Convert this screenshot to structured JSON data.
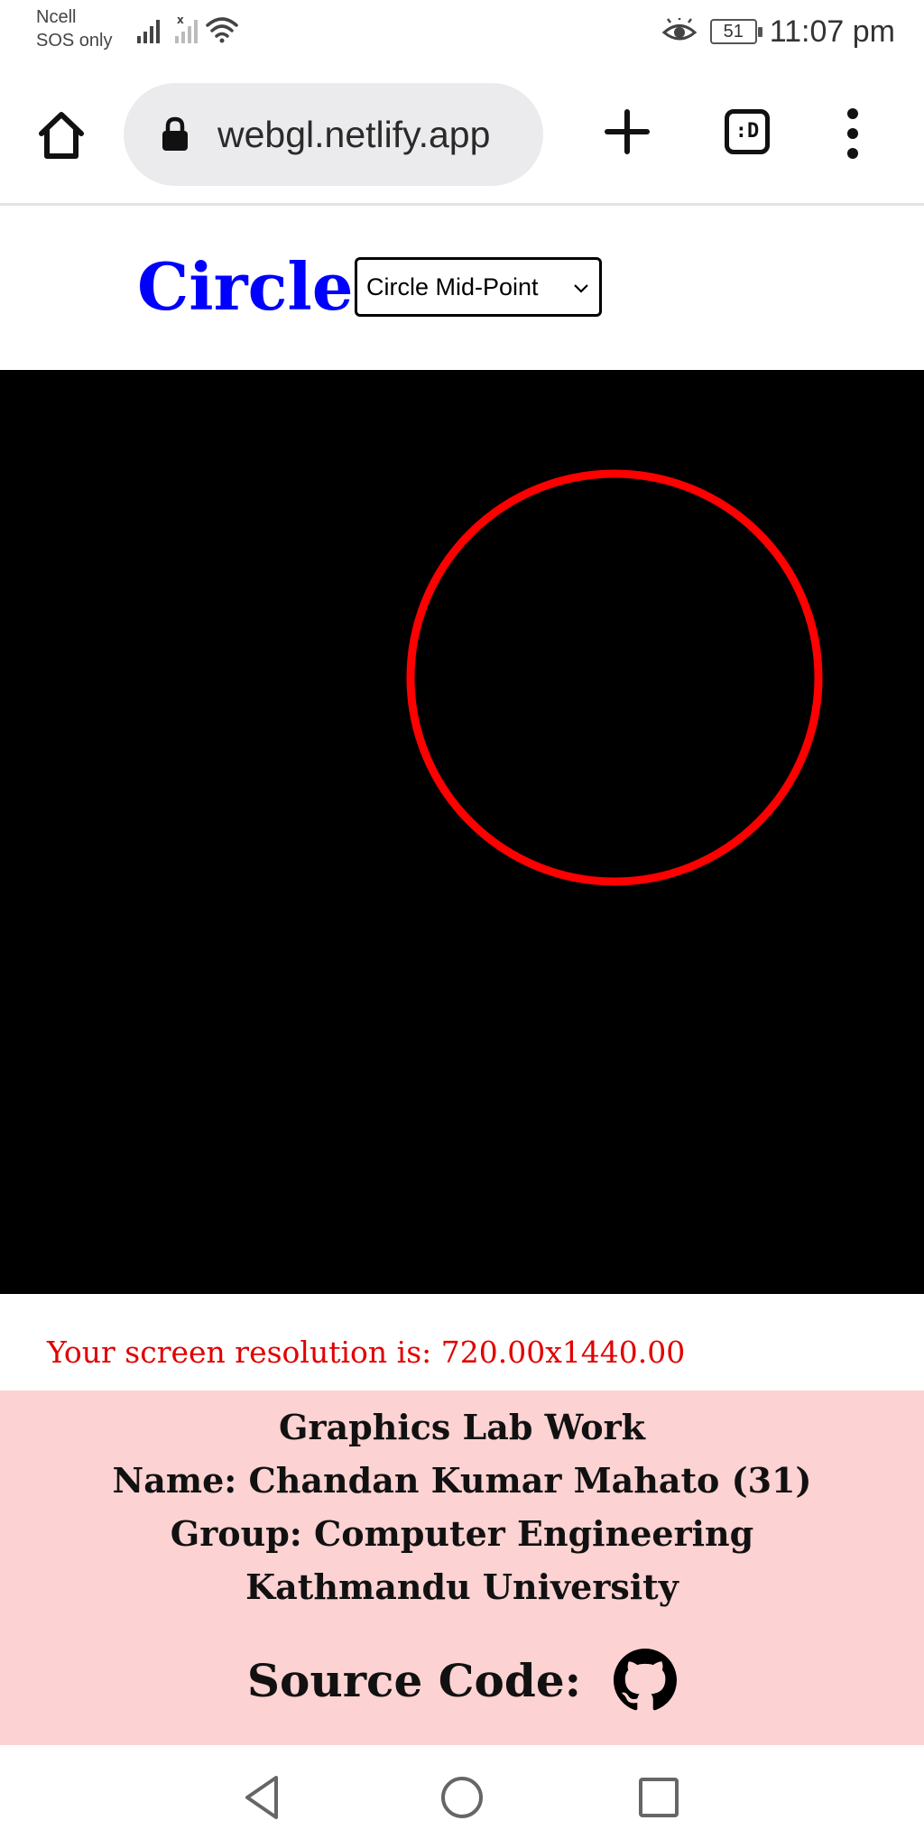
{
  "status_bar": {
    "carrier_line1": "Ncell",
    "carrier_line2": "SOS only",
    "battery_level": "51",
    "time": "11:07 pm"
  },
  "browser": {
    "url": "webgl.netlify.app",
    "tabs_label": ":D"
  },
  "header": {
    "title": "Circle",
    "algorithm_select": {
      "selected": "Circle Mid-Point"
    }
  },
  "canvas": {
    "background": "#000000",
    "shape": "circle",
    "stroke_color": "#ff0000"
  },
  "resolution_text": "Your screen resolution is: 720.00x1440.00",
  "footer": {
    "line1": "Graphics Lab Work",
    "line2": "Name: Chandan Kumar Mahato (31)",
    "line3": "Group: Computer Engineering",
    "line4": "Kathmandu University",
    "source_label": "Source Code:",
    "source_icon": "github-icon",
    "background": "#fcd2d2"
  },
  "colors": {
    "title": "#0000ff",
    "resolution": "#e00000"
  }
}
